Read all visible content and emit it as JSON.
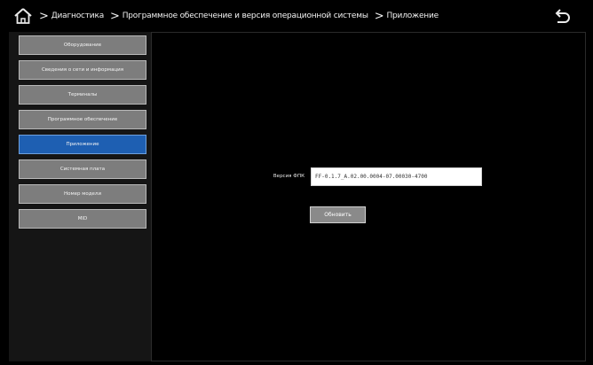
{
  "header": {
    "breadcrumb": [
      "Диагностика",
      "Программное обеспечение и версия операционной системы",
      "Приложение"
    ]
  },
  "sidebar": {
    "items": [
      {
        "label": "Оборудование",
        "active": false
      },
      {
        "label": "Сведения о сети и информация",
        "active": false
      },
      {
        "label": "Терминалы",
        "active": false
      },
      {
        "label": "Программное обеспечение",
        "active": false
      },
      {
        "label": "Приложение",
        "active": true
      },
      {
        "label": "Системная плата",
        "active": false
      },
      {
        "label": "Номер модели",
        "active": false
      },
      {
        "label": "MID",
        "active": false
      }
    ]
  },
  "main": {
    "fw_label": "Версия ФПК",
    "fw_value": "FF-0.1.7_A.02.00.0004-07.00030-4700",
    "update_label": "Обновить"
  },
  "colors": {
    "background": "#000000",
    "active_item": "#1e5fb2",
    "item": "#7d7d7d"
  },
  "icons": {
    "home": "home-icon",
    "back": "back-arrow-icon",
    "separator": "chevron-right-icon"
  }
}
